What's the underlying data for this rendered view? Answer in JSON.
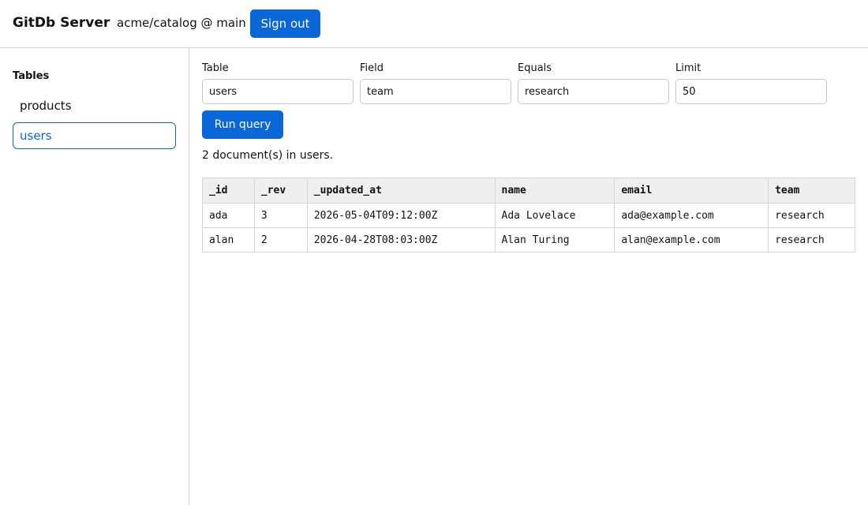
{
  "header": {
    "app_title": "GitDb Server",
    "repo": "acme/catalog @ main",
    "sign_out_label": "Sign out"
  },
  "sidebar": {
    "title": "Tables",
    "items": [
      {
        "label": "products",
        "active": false
      },
      {
        "label": "users",
        "active": true
      }
    ]
  },
  "query": {
    "table_label": "Table",
    "table_value": "users",
    "field_label": "Field",
    "field_value": "team",
    "equals_label": "Equals",
    "equals_value": "research",
    "limit_label": "Limit",
    "limit_value": "50",
    "run_label": "Run query"
  },
  "results": {
    "summary": "2 document(s) in users.",
    "columns": [
      "_id",
      "_rev",
      "_updated_at",
      "name",
      "email",
      "team"
    ],
    "rows": [
      [
        "ada",
        "3",
        "2026-05-04T09:12:00Z",
        "Ada Lovelace",
        "ada@example.com",
        "research"
      ],
      [
        "alan",
        "2",
        "2026-04-28T08:03:00Z",
        "Alan Turing",
        "alan@example.com",
        "research"
      ]
    ]
  }
}
